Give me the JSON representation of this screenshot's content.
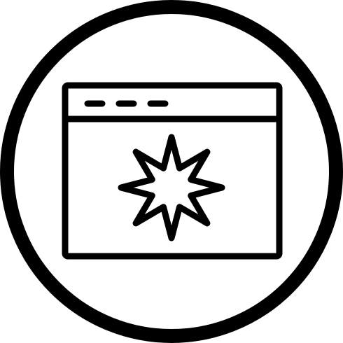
{
  "icon": {
    "name": "browser-window-starburst-icon",
    "stroke_color": "#000000",
    "background_color": "#ffffff",
    "parts": [
      "outer-circle",
      "browser-window",
      "title-bar",
      "window-dots",
      "starburst"
    ]
  }
}
